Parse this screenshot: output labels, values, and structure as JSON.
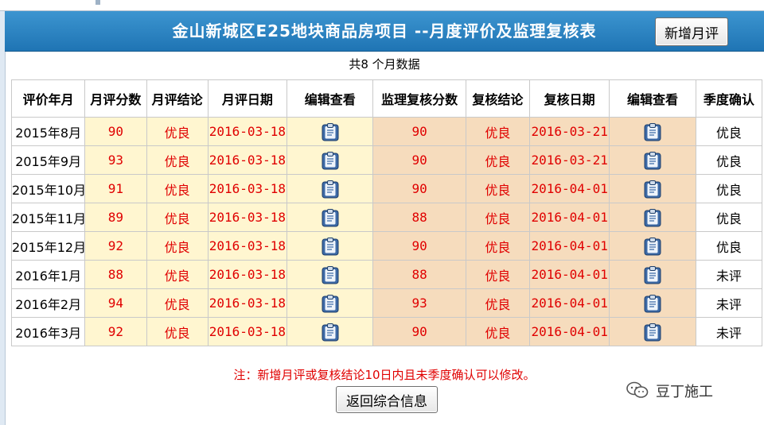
{
  "header": {
    "title": "金山新城区E25地块商品房项目 --月度评价及监理复核表",
    "add_button": "新增月评"
  },
  "summary": "共8 个月数据",
  "table": {
    "columns": [
      "评价年月",
      "月评分数",
      "月评结论",
      "月评日期",
      "编辑查看",
      "监理复核分数",
      "复核结论",
      "复核日期",
      "编辑查看",
      "季度确认"
    ],
    "rows": [
      {
        "month": "2015年8月",
        "score": "90",
        "result": "优良",
        "date": "2016-03-18",
        "review_score": "90",
        "review_result": "优良",
        "review_date": "2016-03-21",
        "quarter": "优良"
      },
      {
        "month": "2015年9月",
        "score": "93",
        "result": "优良",
        "date": "2016-03-18",
        "review_score": "90",
        "review_result": "优良",
        "review_date": "2016-03-21",
        "quarter": "优良"
      },
      {
        "month": "2015年10月",
        "score": "91",
        "result": "优良",
        "date": "2016-03-18",
        "review_score": "90",
        "review_result": "优良",
        "review_date": "2016-04-01",
        "quarter": "优良"
      },
      {
        "month": "2015年11月",
        "score": "89",
        "result": "优良",
        "date": "2016-03-18",
        "review_score": "88",
        "review_result": "优良",
        "review_date": "2016-04-01",
        "quarter": "优良"
      },
      {
        "month": "2015年12月",
        "score": "92",
        "result": "优良",
        "date": "2016-03-18",
        "review_score": "90",
        "review_result": "优良",
        "review_date": "2016-04-01",
        "quarter": "优良"
      },
      {
        "month": "2016年1月",
        "score": "88",
        "result": "优良",
        "date": "2016-03-18",
        "review_score": "88",
        "review_result": "优良",
        "review_date": "2016-04-01",
        "quarter": "未评"
      },
      {
        "month": "2016年2月",
        "score": "94",
        "result": "优良",
        "date": "2016-03-18",
        "review_score": "93",
        "review_result": "优良",
        "review_date": "2016-04-01",
        "quarter": "未评"
      },
      {
        "month": "2016年3月",
        "score": "92",
        "result": "优良",
        "date": "2016-03-18",
        "review_score": "90",
        "review_result": "优良",
        "review_date": "2016-04-01",
        "quarter": "未评"
      }
    ]
  },
  "note": "注：新增月评或复核结论10日内且未季度确认可以修改。",
  "back_button": "返回综合信息",
  "watermark": "豆丁施工",
  "icons": {
    "edit_view": "clipboard-icon",
    "brand": "wechat-icon"
  },
  "colors": {
    "header": "#2a83c3",
    "value_red": "#e00000",
    "cream": "#fff6d0",
    "tan": "#f6dcbd"
  }
}
